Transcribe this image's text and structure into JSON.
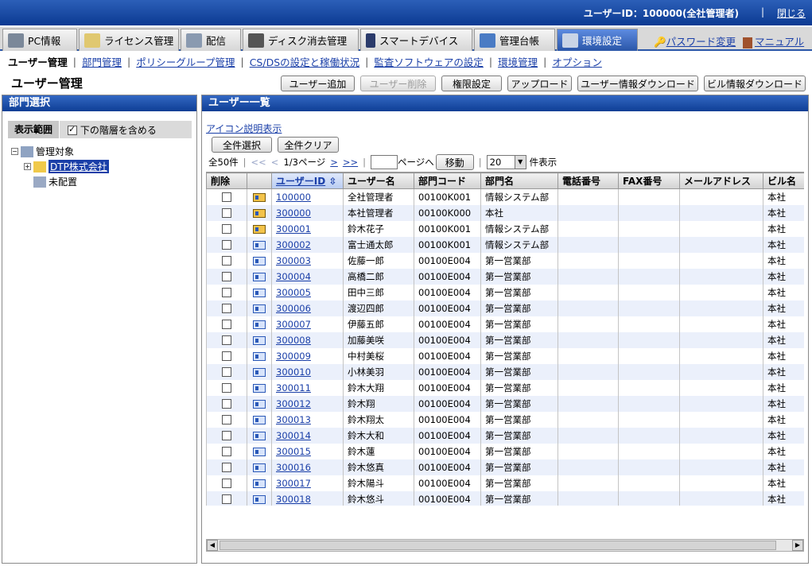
{
  "header": {
    "user_info": "ユーザーID：100000(全社管理者)",
    "separator": "|",
    "close_label": "閉じる"
  },
  "tabs": [
    {
      "label": "PC情報"
    },
    {
      "label": "ライセンス管理"
    },
    {
      "label": "配信"
    },
    {
      "label": "ディスク消去管理"
    },
    {
      "label": "スマートデバイス"
    },
    {
      "label": "管理台帳"
    },
    {
      "label": "環境設定"
    }
  ],
  "tab_extras": {
    "password": "パスワード変更",
    "manual": "マニュアル"
  },
  "subnav": {
    "current": "ユーザー管理",
    "items": [
      "部門管理",
      "ポリシーグループ管理",
      "CS/DSの設定と稼働状況",
      "監査ソフトウェアの設定",
      "環境管理",
      "オプション"
    ]
  },
  "page_title": "ユーザー管理",
  "toolbar": {
    "add": "ユーザー追加",
    "delete": "ユーザー削除",
    "perm": "権限設定",
    "upload": "アップロード",
    "download_user": "ユーザー情報ダウンロード",
    "download_bill": "ビル情報ダウンロード"
  },
  "left_panel": {
    "title": "部門選択",
    "scope_label": "表示範囲",
    "scope_checkbox": "下の階層を含める",
    "tree": {
      "root": "管理対象",
      "company": "DTP株式会社",
      "unassigned": "未配置"
    }
  },
  "right_panel": {
    "title": "ユーザー一覧",
    "icon_legend_link": "アイコン説明表示",
    "select_all": "全件選択",
    "clear_all": "全件クリア",
    "total": "全50件",
    "first": "<<",
    "prev": "<",
    "page_info": "1/3ページ",
    "next": ">",
    "last": ">>",
    "page_input_value": "",
    "page_suffix": "ページへ",
    "go_button": "移動",
    "per_page": "20",
    "per_page_suffix": "件表示"
  },
  "table": {
    "columns": [
      "削除",
      "",
      "ユーザーID",
      "ユーザー名",
      "部門コード",
      "部門名",
      "電話番号",
      "FAX番号",
      "メールアドレス",
      "ビル名"
    ],
    "sort_indicator": "⇳",
    "rows": [
      {
        "icon": "admin-icon",
        "id": "100000",
        "name": "全社管理者",
        "code": "00100K001",
        "dept": "情報システム部",
        "building": "本社"
      },
      {
        "icon": "manager-card-icon",
        "id": "300000",
        "name": "本社管理者",
        "code": "00100K000",
        "dept": "本社",
        "building": "本社"
      },
      {
        "icon": "manager-card-icon",
        "id": "300001",
        "name": "鈴木花子",
        "code": "00100K001",
        "dept": "情報システム部",
        "building": "本社"
      },
      {
        "icon": "user-card-icon",
        "id": "300002",
        "name": "富士通太郎",
        "code": "00100K001",
        "dept": "情報システム部",
        "building": "本社"
      },
      {
        "icon": "user-card-icon",
        "id": "300003",
        "name": "佐藤一郎",
        "code": "00100E004",
        "dept": "第一営業部",
        "building": "本社"
      },
      {
        "icon": "user-card-icon",
        "id": "300004",
        "name": "高橋二郎",
        "code": "00100E004",
        "dept": "第一営業部",
        "building": "本社"
      },
      {
        "icon": "user-card-icon",
        "id": "300005",
        "name": "田中三郎",
        "code": "00100E004",
        "dept": "第一営業部",
        "building": "本社"
      },
      {
        "icon": "user-card-icon",
        "id": "300006",
        "name": "渡辺四郎",
        "code": "00100E004",
        "dept": "第一営業部",
        "building": "本社"
      },
      {
        "icon": "user-card-icon",
        "id": "300007",
        "name": "伊藤五郎",
        "code": "00100E004",
        "dept": "第一営業部",
        "building": "本社"
      },
      {
        "icon": "user-card-icon",
        "id": "300008",
        "name": "加藤美咲",
        "code": "00100E004",
        "dept": "第一営業部",
        "building": "本社"
      },
      {
        "icon": "user-card-icon",
        "id": "300009",
        "name": "中村美桜",
        "code": "00100E004",
        "dept": "第一営業部",
        "building": "本社"
      },
      {
        "icon": "user-card-icon",
        "id": "300010",
        "name": "小林美羽",
        "code": "00100E004",
        "dept": "第一営業部",
        "building": "本社"
      },
      {
        "icon": "user-card-icon",
        "id": "300011",
        "name": "鈴木大翔",
        "code": "00100E004",
        "dept": "第一営業部",
        "building": "本社"
      },
      {
        "icon": "user-card-icon",
        "id": "300012",
        "name": "鈴木翔",
        "code": "00100E004",
        "dept": "第一営業部",
        "building": "本社"
      },
      {
        "icon": "user-card-icon",
        "id": "300013",
        "name": "鈴木翔太",
        "code": "00100E004",
        "dept": "第一営業部",
        "building": "本社"
      },
      {
        "icon": "user-card-icon",
        "id": "300014",
        "name": "鈴木大和",
        "code": "00100E004",
        "dept": "第一営業部",
        "building": "本社"
      },
      {
        "icon": "user-card-icon",
        "id": "300015",
        "name": "鈴木蓮",
        "code": "00100E004",
        "dept": "第一営業部",
        "building": "本社"
      },
      {
        "icon": "user-card-icon",
        "id": "300016",
        "name": "鈴木悠真",
        "code": "00100E004",
        "dept": "第一営業部",
        "building": "本社"
      },
      {
        "icon": "user-card-icon",
        "id": "300017",
        "name": "鈴木陽斗",
        "code": "00100E004",
        "dept": "第一営業部",
        "building": "本社"
      },
      {
        "icon": "user-card-icon",
        "id": "300018",
        "name": "鈴木悠斗",
        "code": "00100E004",
        "dept": "第一営業部",
        "building": "本社"
      }
    ]
  },
  "colors": {
    "header_blue": "#0b3a92",
    "active_tab": "#2a56a8",
    "link": "#1a3fa8",
    "row_alt": "#ebf0fb"
  }
}
